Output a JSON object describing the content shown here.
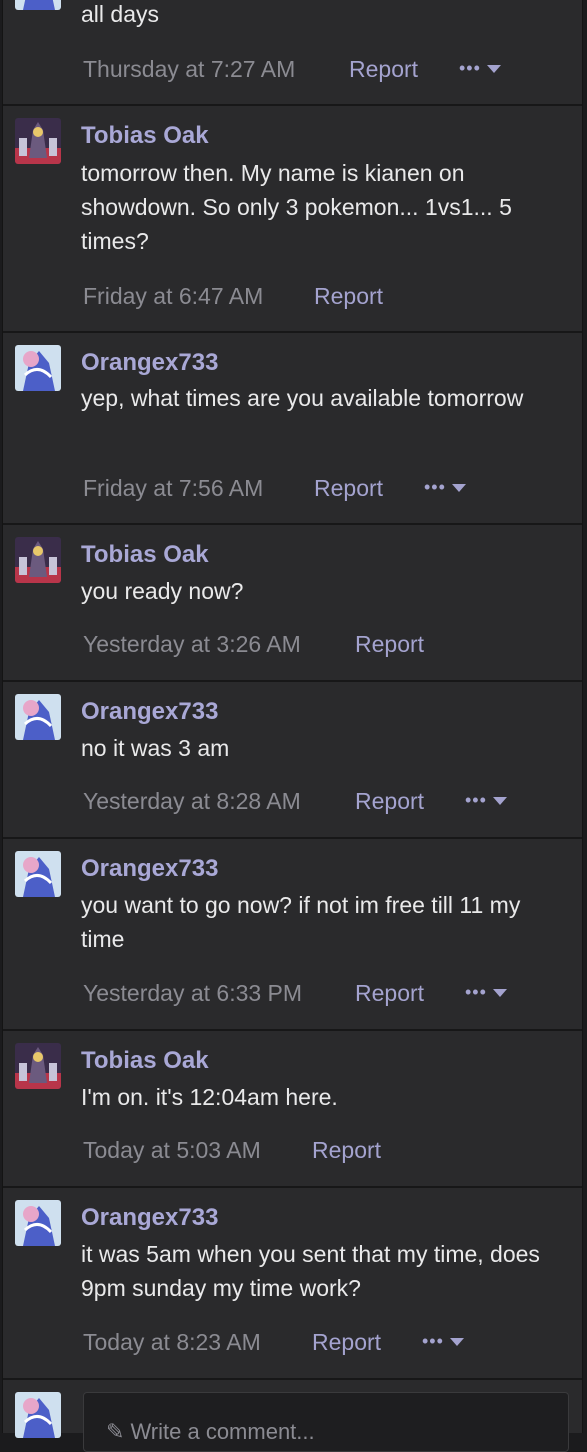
{
  "comments": [
    {
      "author": "",
      "avatar": "orange",
      "text": "all days",
      "time": "Thursday at 7:27 AM",
      "report": "Report",
      "has_more": true
    },
    {
      "author": "Tobias Oak",
      "avatar": "tobias",
      "text": "tomorrow then. My name is kianen on showdown. So only 3 pokemon... 1vs1... 5 times?",
      "time": "Friday at 6:47 AM",
      "report": "Report",
      "has_more": false
    },
    {
      "author": "Orangex733",
      "avatar": "orange",
      "text": "yep, what times are you available tomorrow",
      "time": "Friday at 7:56 AM",
      "report": "Report",
      "has_more": true
    },
    {
      "author": "Tobias Oak",
      "avatar": "tobias",
      "text": "you ready now?",
      "time": "Yesterday at 3:26 AM",
      "report": "Report",
      "has_more": false
    },
    {
      "author": "Orangex733",
      "avatar": "orange",
      "text": "no it was 3 am",
      "time": "Yesterday at 8:28 AM",
      "report": "Report",
      "has_more": true
    },
    {
      "author": "Orangex733",
      "avatar": "orange",
      "text": "you want to go now? if not im free till 11 my time",
      "time": "Yesterday at 6:33 PM",
      "report": "Report",
      "has_more": true
    },
    {
      "author": "Tobias Oak",
      "avatar": "tobias",
      "text": "I'm on. it's 12:04am here.",
      "time": "Today at 5:03 AM",
      "report": "Report",
      "has_more": false
    },
    {
      "author": "Orangex733",
      "avatar": "orange",
      "text": "it was 5am when you sent that my time, does 9pm sunday my time work?",
      "time": "Today at 8:23 AM",
      "report": "Report",
      "has_more": true
    }
  ],
  "composer": {
    "placeholder": "Write a comment..."
  },
  "colors": {
    "author": "#a9a8d6",
    "link": "#a4a3cf",
    "meta": "#8b8b92",
    "text": "#e9e9ea",
    "panel": "#2a2a2c"
  }
}
